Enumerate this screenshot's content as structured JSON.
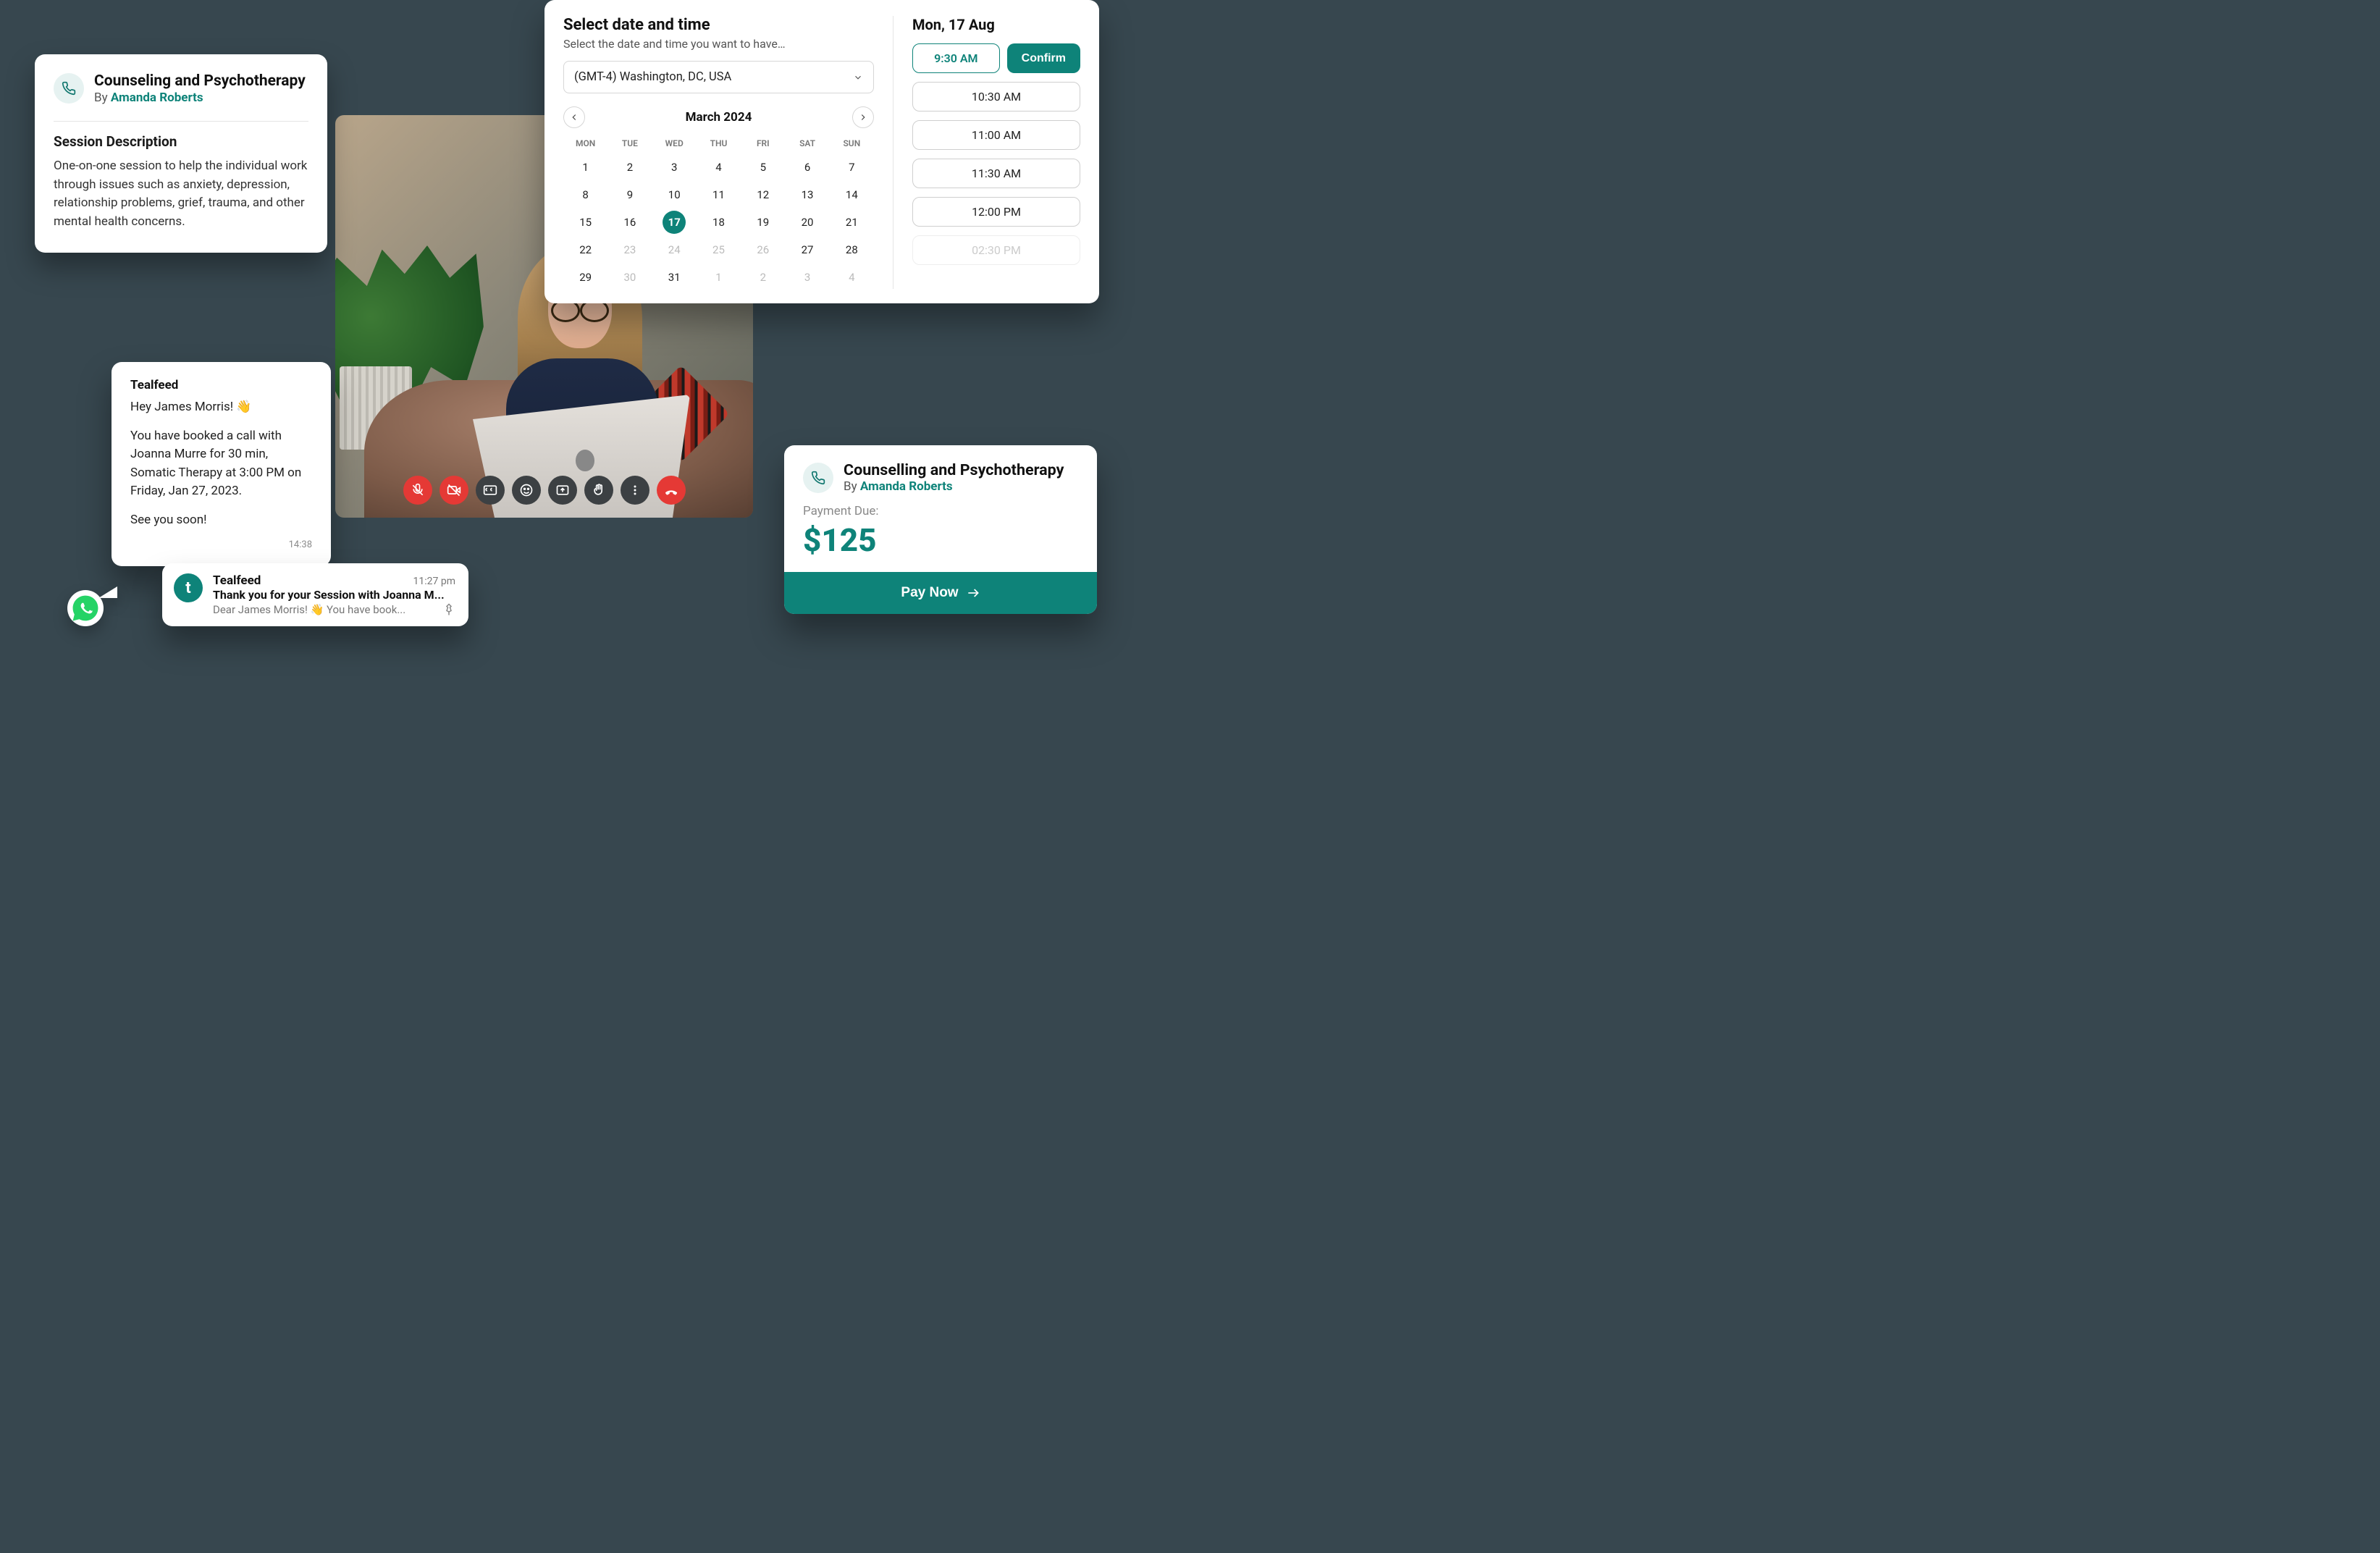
{
  "colors": {
    "accent": "#0e8379"
  },
  "sessionCard": {
    "title": "Counseling and Psychotherapy",
    "byPrefix": "By ",
    "provider": "Amanda Roberts",
    "descHeading": "Session Description",
    "description": "One-on-one session to help the individual work through issues such as anxiety, depression, relationship problems, grief, trauma, and other mental health concerns."
  },
  "picker": {
    "heading": "Select date and time",
    "sub": "Select the date and time you want to have…",
    "timezone": "(GMT-4) Washington, DC, USA",
    "month": "March 2024",
    "dow": [
      "MON",
      "TUE",
      "WED",
      "THU",
      "FRI",
      "SAT",
      "SUN"
    ],
    "days": [
      {
        "n": "1"
      },
      {
        "n": "2"
      },
      {
        "n": "3"
      },
      {
        "n": "4"
      },
      {
        "n": "5"
      },
      {
        "n": "6"
      },
      {
        "n": "7"
      },
      {
        "n": "8"
      },
      {
        "n": "9"
      },
      {
        "n": "10"
      },
      {
        "n": "11"
      },
      {
        "n": "12"
      },
      {
        "n": "13"
      },
      {
        "n": "14"
      },
      {
        "n": "15"
      },
      {
        "n": "16"
      },
      {
        "n": "17",
        "sel": true
      },
      {
        "n": "18"
      },
      {
        "n": "19"
      },
      {
        "n": "20"
      },
      {
        "n": "21"
      },
      {
        "n": "22"
      },
      {
        "n": "23",
        "muted": true
      },
      {
        "n": "24",
        "muted": true
      },
      {
        "n": "25",
        "muted": true
      },
      {
        "n": "26",
        "muted": true
      },
      {
        "n": "27"
      },
      {
        "n": "28"
      },
      {
        "n": "29"
      },
      {
        "n": "30",
        "muted": true
      },
      {
        "n": "31"
      },
      {
        "n": "1",
        "muted": true
      },
      {
        "n": "2",
        "muted": true
      },
      {
        "n": "3",
        "muted": true
      },
      {
        "n": "4",
        "muted": true
      }
    ],
    "selectedDate": "Mon, 17 Aug",
    "confirmLabel": "Confirm",
    "slots": [
      {
        "t": "9:30 AM",
        "sel": true
      },
      {
        "t": "10:30 AM"
      },
      {
        "t": "11:00 AM"
      },
      {
        "t": "11:30 AM"
      },
      {
        "t": "12:00 PM"
      },
      {
        "t": "02:30 PM",
        "faded": true
      }
    ]
  },
  "chat": {
    "sender": "Tealfeed",
    "greeting": "Hey James Morris! 👋",
    "body": "You have booked a call with Joanna Murre for 30 min, Somatic Therapy at 3:00 PM on Friday, Jan 27, 2023.",
    "closing": "See you soon!",
    "time": "14:38"
  },
  "notif": {
    "avatarLetter": "t",
    "sender": "Tealfeed",
    "time": "11:27 pm",
    "line1": "Thank you for your Session with Joanna M...",
    "line2": "Dear James Morris! 👋 You have book..."
  },
  "payment": {
    "title": "Counselling and Psychotherapy",
    "byPrefix": "By ",
    "provider": "Amanda Roberts",
    "dueLabel": "Payment Due:",
    "amount": "$125",
    "button": "Pay Now"
  },
  "icons": {
    "phone": "phone-icon",
    "micOff": "mic-off-icon",
    "videoOff": "video-off-icon",
    "cc": "captions-icon",
    "emoji": "emoji-icon",
    "screen": "present-screen-icon",
    "hand": "raise-hand-icon",
    "more": "more-options-icon",
    "hangup": "hang-up-icon",
    "chevDown": "chevron-down-icon",
    "chevLeft": "chevron-left-icon",
    "chevRight": "chevron-right-icon",
    "arrowRight": "arrow-right-icon",
    "whatsapp": "whatsapp-icon",
    "pin": "pin-icon"
  }
}
